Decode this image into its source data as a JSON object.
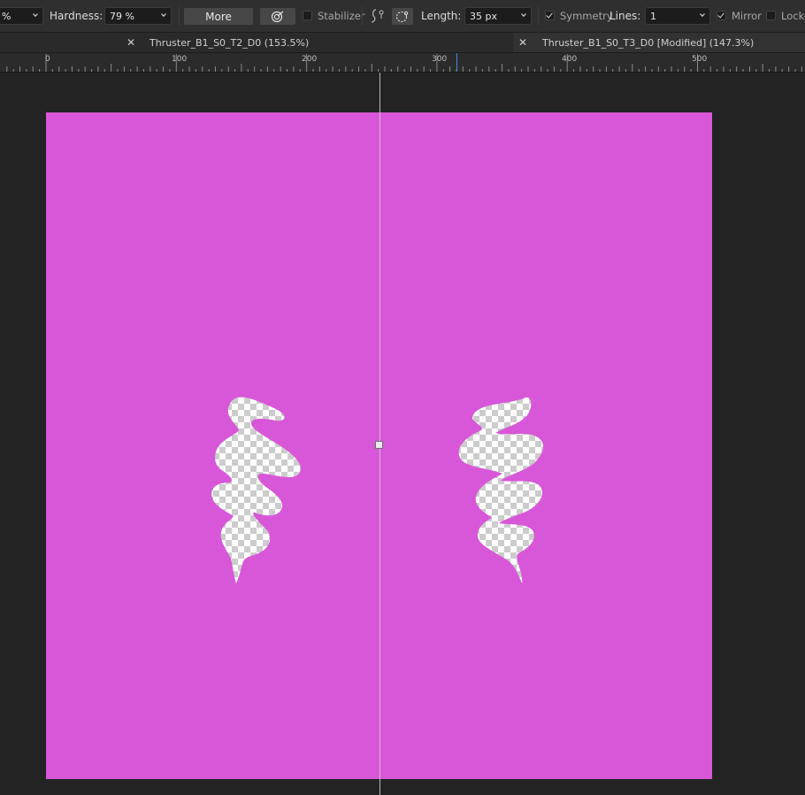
{
  "toolbar": {
    "opacity_value": "%",
    "hardness_label": "Hardness:",
    "hardness_value": "79 %",
    "more_label": "More",
    "stabilizer_label": "Stabilizer",
    "length_label": "Length:",
    "length_value": "35 px",
    "symmetry_label": "Symmetry",
    "symmetry_checked": true,
    "lines_label": "Lines:",
    "lines_value": "1",
    "mirror_label": "Mirror",
    "mirror_checked": true,
    "locked_label": "Locke",
    "icons": [
      "chevron-down-icon",
      "force-pressure-icon",
      "rope-mode-icon",
      "window-mode-icon"
    ]
  },
  "tabs": [
    {
      "label": "Thruster_B1_S0_T2_D0 (153.5%)",
      "active": false
    },
    {
      "label": "Thruster_B1_S0_T3_D0 [Modified] (147.3%)",
      "active": true
    }
  ],
  "ruler": {
    "labels": [
      "0",
      "100",
      "200",
      "300",
      "400",
      "500"
    ]
  },
  "canvas": {
    "background_color": "#d857d8",
    "transparent_hole_icons": [
      "zigzag-brush-stroke-left",
      "zigzag-brush-stroke-right"
    ]
  },
  "colors": {
    "toolbar_bg": "#2f2f2f",
    "workspace_bg": "#232323",
    "accent_blue": "#4a86d8"
  }
}
